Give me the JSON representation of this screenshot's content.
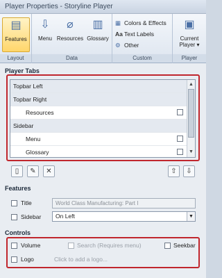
{
  "window": {
    "title": "Player Properties - Storyline Player"
  },
  "ribbon": {
    "groups": [
      {
        "label": "Layout",
        "buttons": [
          {
            "label": "Features",
            "icon": "features-icon",
            "active": true
          }
        ]
      },
      {
        "label": "Data",
        "buttons": [
          {
            "label": "Menu",
            "icon": "menu-icon"
          },
          {
            "label": "Resources",
            "icon": "paperclip-icon"
          },
          {
            "label": "Glossary",
            "icon": "glossary-icon"
          }
        ]
      },
      {
        "label": "Custom",
        "buttons": [
          {
            "label": "Colors & Effects",
            "icon": "palette-icon"
          },
          {
            "label": "Text Labels",
            "icon": "text-icon"
          },
          {
            "label": "Other",
            "icon": "gear-icon"
          }
        ]
      },
      {
        "label": "Player",
        "buttons": [
          {
            "label": "Current Player",
            "icon": "player-icon"
          }
        ]
      }
    ]
  },
  "player_tabs": {
    "title": "Player Tabs",
    "rows": [
      {
        "label": "Topbar Left",
        "type": "group"
      },
      {
        "label": "Topbar Right",
        "type": "group"
      },
      {
        "label": "Resources",
        "type": "item"
      },
      {
        "label": "Sidebar",
        "type": "group"
      },
      {
        "label": "Menu",
        "type": "item"
      },
      {
        "label": "Glossary",
        "type": "item"
      }
    ]
  },
  "features": {
    "title": "Features",
    "title_label": "Title",
    "title_value": "World Class Manufacturing: Part I",
    "sidebar_label": "Sidebar",
    "sidebar_value": "On Left"
  },
  "controls": {
    "title": "Controls",
    "volume_label": "Volume",
    "search_label": "Search (Requires menu)",
    "seekbar_label": "Seekbar",
    "logo_label": "Logo",
    "logo_hint": "Click to add a logo..."
  }
}
